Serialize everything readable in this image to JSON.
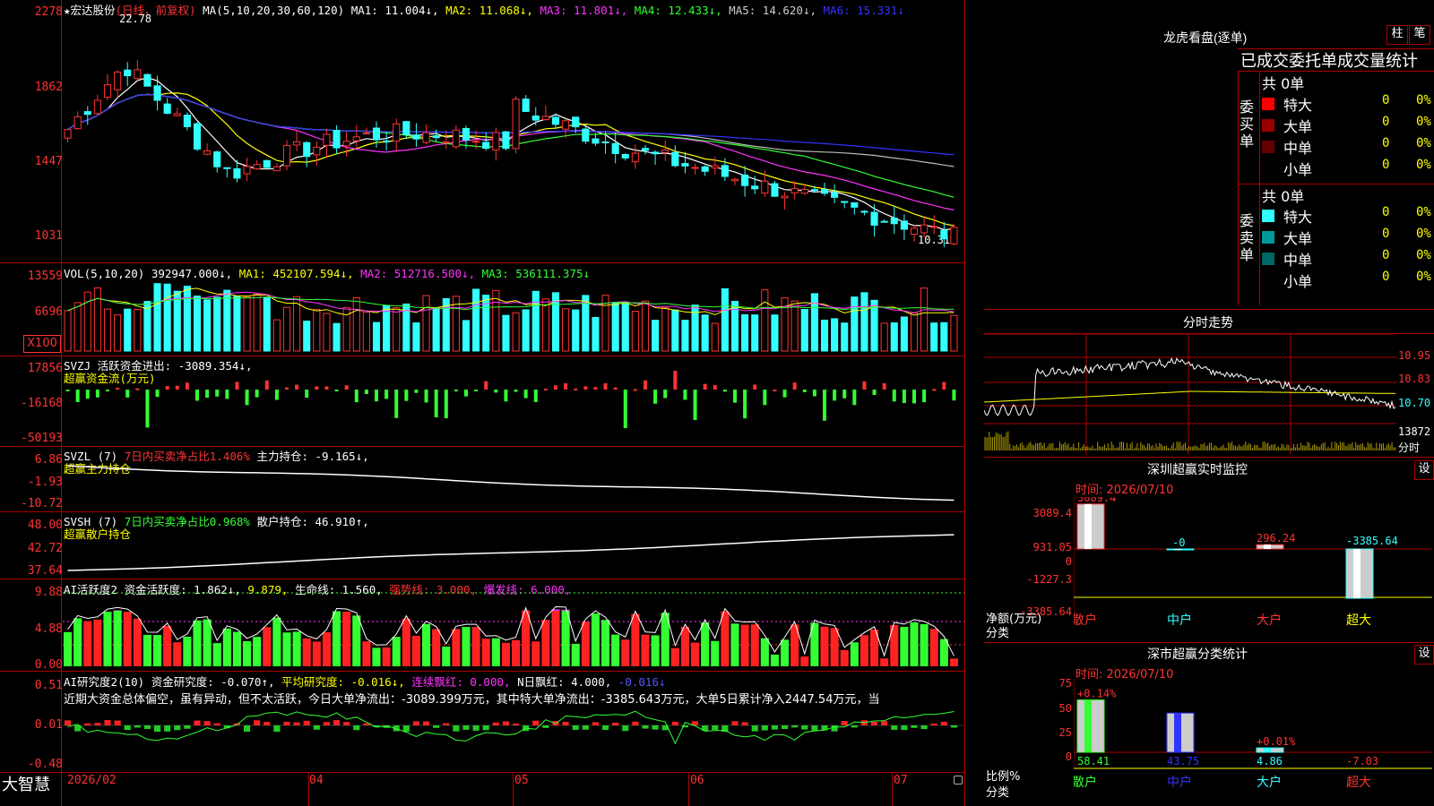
{
  "stock": {
    "star": "★",
    "name": "宏达股份",
    "mode": "(日线，前复权)"
  },
  "price_pane": {
    "ma_label": "MA(5,10,20,30,60,120)",
    "ma": [
      {
        "label": "MA1: 11.004↓,",
        "color": "#ffffff"
      },
      {
        "label": "MA2: 11.068↓,",
        "color": "#ffff00"
      },
      {
        "label": "MA3: 11.801↓,",
        "color": "#ff33ff"
      },
      {
        "label": "MA4: 12.433↓,",
        "color": "#33ff33"
      },
      {
        "label": "MA5: 14.620↓,",
        "color": "#cccccc"
      },
      {
        "label": "MA6: 15.331↓",
        "color": "#3333ff"
      }
    ],
    "y_ticks": [
      "2278",
      "1862",
      "1447",
      "1031"
    ],
    "high_label": "22.78",
    "low_label": "10.31"
  },
  "vol_pane": {
    "label": "VOL(5,10,20)",
    "vol": "392947.000↓,",
    "ma1": "MA1: 452107.594↓,",
    "ma2": "MA2: 512716.500↓,",
    "ma3": "MA3: 536111.375↓",
    "y_ticks": [
      "13559",
      "6696"
    ],
    "unit_btn": "X100"
  },
  "svzj_pane": {
    "label": "SVZJ",
    "text1": "活跃资金进出: -3089.354↓,",
    "text2": "超赢资金流(万元)",
    "y_ticks": [
      "17856",
      "-16168",
      "-50193"
    ]
  },
  "svzl_pane": {
    "label": "SVZL (7)",
    "text1": "7日内买卖净占比1.406%",
    "text2": "主力持仓: -9.165↓,",
    "text3": "超赢主力持仓",
    "y_ticks": [
      "6.86",
      "-1.93",
      "-10.72"
    ]
  },
  "svsh_pane": {
    "label": "SVSH (7)",
    "text1": "7日内买卖净占比0.968%",
    "text2": "散户持仓: 46.910↑,",
    "text3": "超赢散户持仓",
    "y_ticks": [
      "48.00",
      "42.72",
      "37.64"
    ]
  },
  "ai_active_pane": {
    "label": "AI活跃度2",
    "t1": "资金活跃度: 1.862↓,",
    "t2": "9.879,",
    "t3": "生命线: 1.560,",
    "t4": "强势线: 3.000,",
    "t5": "爆发线: 6.000,",
    "y_ticks": [
      "9.88",
      "4.88",
      "0.00"
    ]
  },
  "ai_research_pane": {
    "label": "AI研究度2(10)",
    "t1": "资金研究度: -0.070↑,",
    "t2": "平均研究度: -0.016↓,",
    "t3": "连续飘红: 0.000,",
    "t4": "N日飘红: 4.000,",
    "t5": "-0.016↓",
    "summary": "近期大资金总体偏空，虽有异动，但不太活跃，今日大单净流出：-3089.399万元，其中特大单净流出：-3385.643万元，大单5日累计净入2447.54万元，当",
    "y_ticks": [
      "0.51",
      "0.01",
      "-0.48"
    ]
  },
  "bottom": {
    "brand": "大智慧",
    "dates": [
      "2026/02",
      "04",
      "05",
      "06",
      "07"
    ]
  },
  "dragon_tiger": {
    "title": "龙虎看盘(逐单)",
    "btn1": "柱",
    "btn2": "笔",
    "heading": "已成交委托单成交量统计",
    "buy_label": "委买单",
    "sell_label": "委卖单",
    "buy_total": "共 0单",
    "sell_total": "共 0单",
    "buy_rows": [
      {
        "name": "特大",
        "count": "0",
        "pct": "0%",
        "color": "#ff0000"
      },
      {
        "name": "大单",
        "count": "0",
        "pct": "0%",
        "color": "#990000"
      },
      {
        "name": "中单",
        "count": "0",
        "pct": "0%",
        "color": "#660000"
      },
      {
        "name": "小单",
        "count": "0",
        "pct": "0%",
        "color": "#000000"
      }
    ],
    "sell_rows": [
      {
        "name": "特大",
        "count": "0",
        "pct": "0%",
        "color": "#33ffff"
      },
      {
        "name": "大单",
        "count": "0",
        "pct": "0%",
        "color": "#009999"
      },
      {
        "name": "中单",
        "count": "0",
        "pct": "0%",
        "color": "#006666"
      },
      {
        "name": "小单",
        "count": "0",
        "pct": "0%",
        "color": "#000000"
      }
    ]
  },
  "intraday": {
    "title": "分时走势",
    "prices": [
      "10.95",
      "10.83",
      "10.70"
    ],
    "vol": "13872",
    "vol_unit": "分时"
  },
  "sz_monitor": {
    "title": "深圳超赢实时监控",
    "btn": "设",
    "time": "时间: 2026/07/10",
    "y_ticks": [
      "3089.4",
      "931.05",
      "0",
      "-1227.3",
      "-3385.64"
    ],
    "ylabel": "净额(万元)",
    "xlabel": "分类",
    "categories": [
      "散户",
      "中户",
      "大户",
      "超大"
    ],
    "values": [
      "3089.4",
      "-0",
      "296.24",
      "-3385.64"
    ]
  },
  "sz_class": {
    "title": "深市超赢分类统计",
    "btn": "设",
    "time": "时间: 2026/07/10",
    "y_ticks": [
      "75",
      "50",
      "25",
      "0"
    ],
    "ylabel": "比例%",
    "xlabel": "分类",
    "categories": [
      "散户",
      "中户",
      "大户",
      "超大"
    ],
    "top_labels": [
      "+0.14%",
      "",
      "+0.01%",
      ""
    ],
    "values": [
      "58.41",
      "43.75",
      "4.86",
      "-7.03"
    ]
  }
}
